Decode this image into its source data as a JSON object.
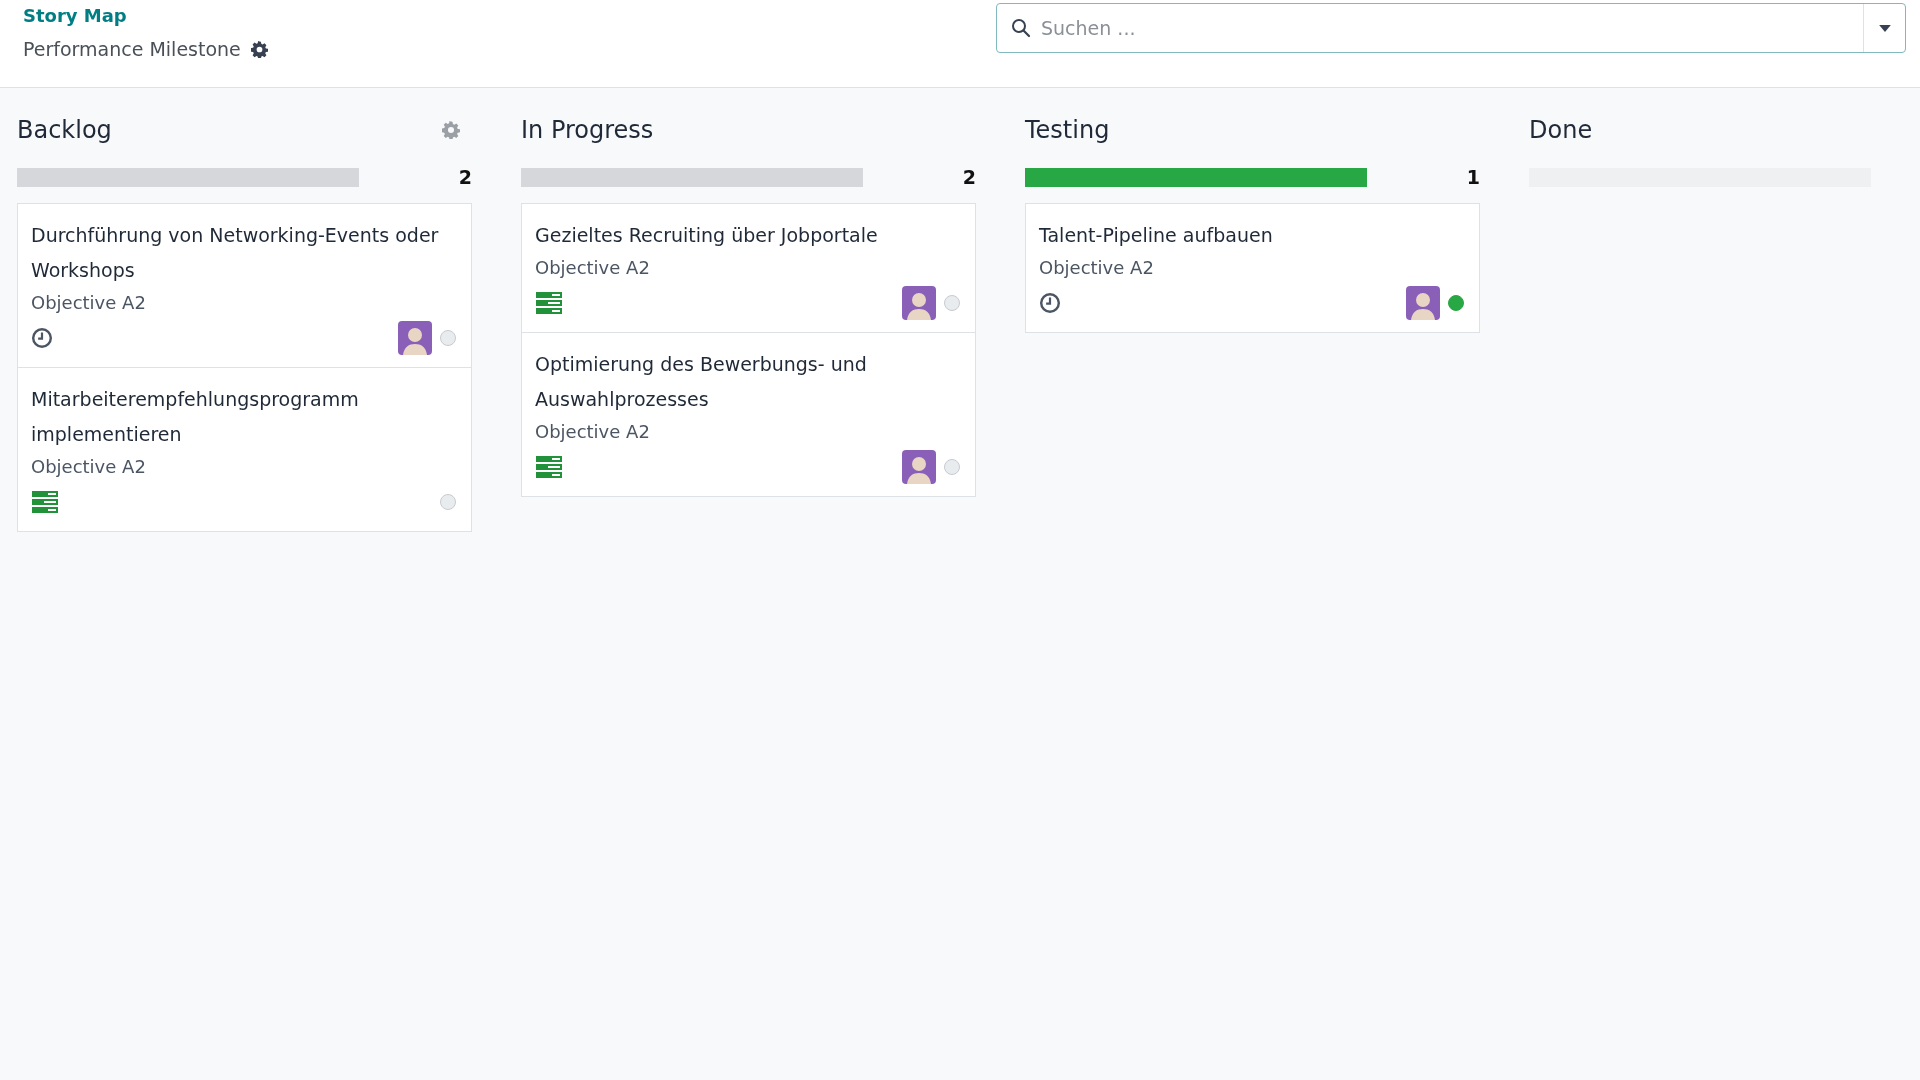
{
  "breadcrumb": {
    "parent": "Story Map",
    "current": "Performance Milestone"
  },
  "search": {
    "placeholder": "Suchen ..."
  },
  "columns": [
    {
      "title": "Backlog",
      "settings": true,
      "level": 1,
      "color": "#d6d7da",
      "count": "2",
      "cards": [
        {
          "title": "Durchführung von Networking-Events oder Workshops",
          "subtitle": "Objective A2",
          "kind": "clock",
          "avatar": true,
          "done": false
        },
        {
          "title": "Mitarbeiterempfehlungsprogramm implementieren",
          "subtitle": "Objective A2",
          "kind": "list",
          "avatar": false,
          "done": false
        }
      ]
    },
    {
      "title": "In Progress",
      "settings": false,
      "level": 1,
      "color": "#d6d7da",
      "count": "2",
      "cards": [
        {
          "title": "Gezieltes Recruiting über Jobportale",
          "subtitle": "Objective A2",
          "kind": "list",
          "avatar": true,
          "done": false
        },
        {
          "title": "Optimierung des Bewerbungs- und Auswahlprozesses",
          "subtitle": "Objective A2",
          "kind": "list",
          "avatar": true,
          "done": false
        }
      ]
    },
    {
      "title": "Testing",
      "settings": false,
      "level": 1,
      "color": "#28a745",
      "count": "1",
      "cards": [
        {
          "title": "Talent-Pipeline aufbauen",
          "subtitle": "Objective A2",
          "kind": "clock",
          "avatar": true,
          "done": true
        }
      ]
    },
    {
      "title": "Done",
      "settings": false
    }
  ]
}
